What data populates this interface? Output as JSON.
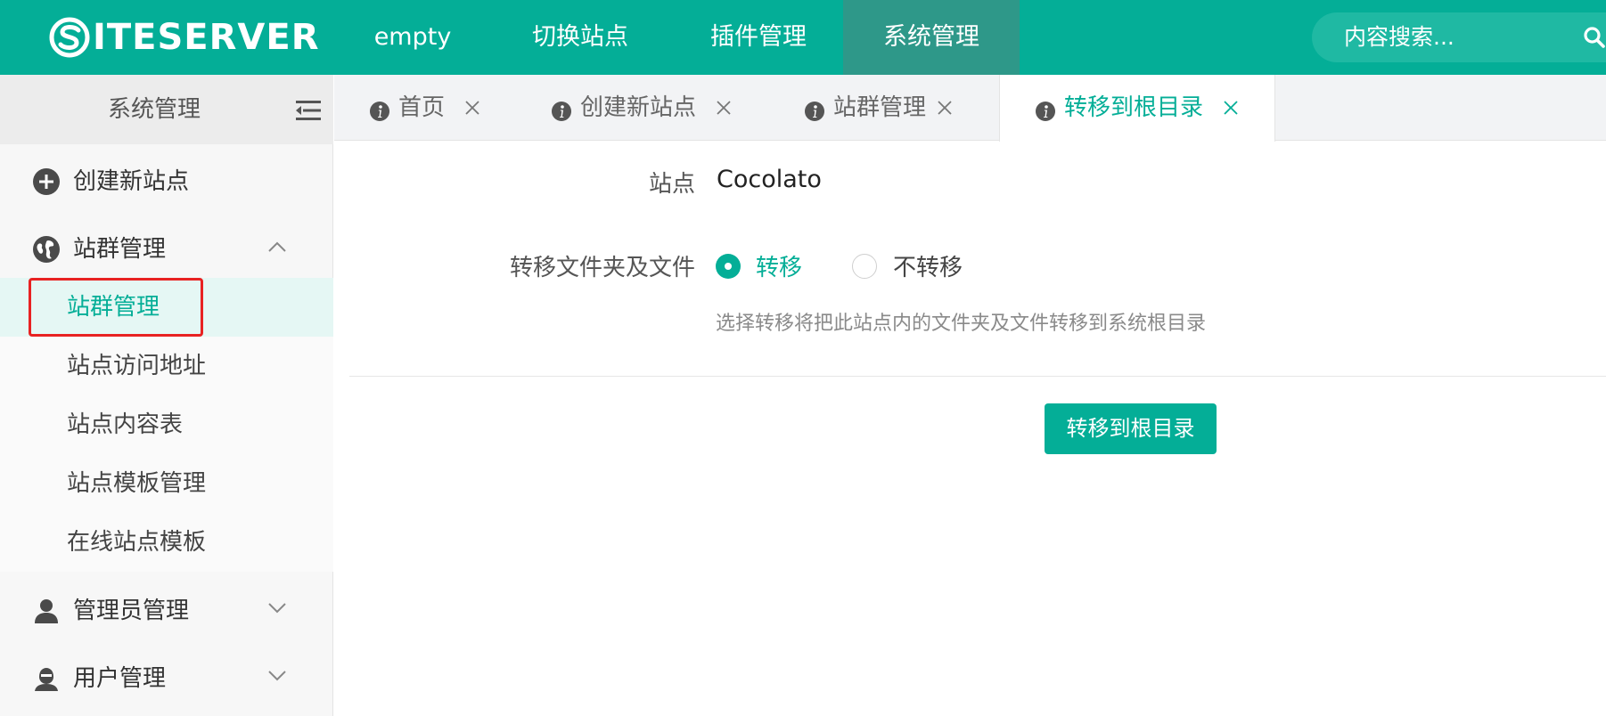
{
  "app": {
    "logo_text": "ITESERVER",
    "brand_color": "#04ae97"
  },
  "topnav": {
    "items": [
      {
        "label": "empty"
      },
      {
        "label": "切换站点"
      },
      {
        "label": "插件管理"
      },
      {
        "label": "系统管理",
        "active": true
      }
    ]
  },
  "search": {
    "placeholder": "内容搜索...",
    "icon": "search-icon"
  },
  "sidebar": {
    "title": "系统管理",
    "fold_icon": "menu-fold-icon",
    "groups": [
      {
        "label": "创建新站点",
        "icon": "plus-circle-icon"
      },
      {
        "label": "站群管理",
        "icon": "globe-icon",
        "expanded": true,
        "children": [
          {
            "label": "站群管理",
            "active": true
          },
          {
            "label": "站点访问地址"
          },
          {
            "label": "站点内容表"
          },
          {
            "label": "站点模板管理"
          },
          {
            "label": "在线站点模板"
          }
        ]
      },
      {
        "label": "管理员管理",
        "icon": "user-icon",
        "expanded": false
      },
      {
        "label": "用户管理",
        "icon": "user-group-icon",
        "expanded": false
      }
    ]
  },
  "tabs": [
    {
      "label": "首页"
    },
    {
      "label": "创建新站点"
    },
    {
      "label": "站群管理"
    },
    {
      "label": "转移到根目录",
      "active": true
    }
  ],
  "form": {
    "site_label": "站点",
    "site_value": "Cocolato",
    "move_label": "转移文件夹及文件",
    "options": [
      {
        "label": "转移",
        "checked": true
      },
      {
        "label": "不转移",
        "checked": false
      }
    ],
    "hint": "选择转移将把此站点内的文件夹及文件转移到系统根目录",
    "submit_label": "转移到根目录"
  }
}
